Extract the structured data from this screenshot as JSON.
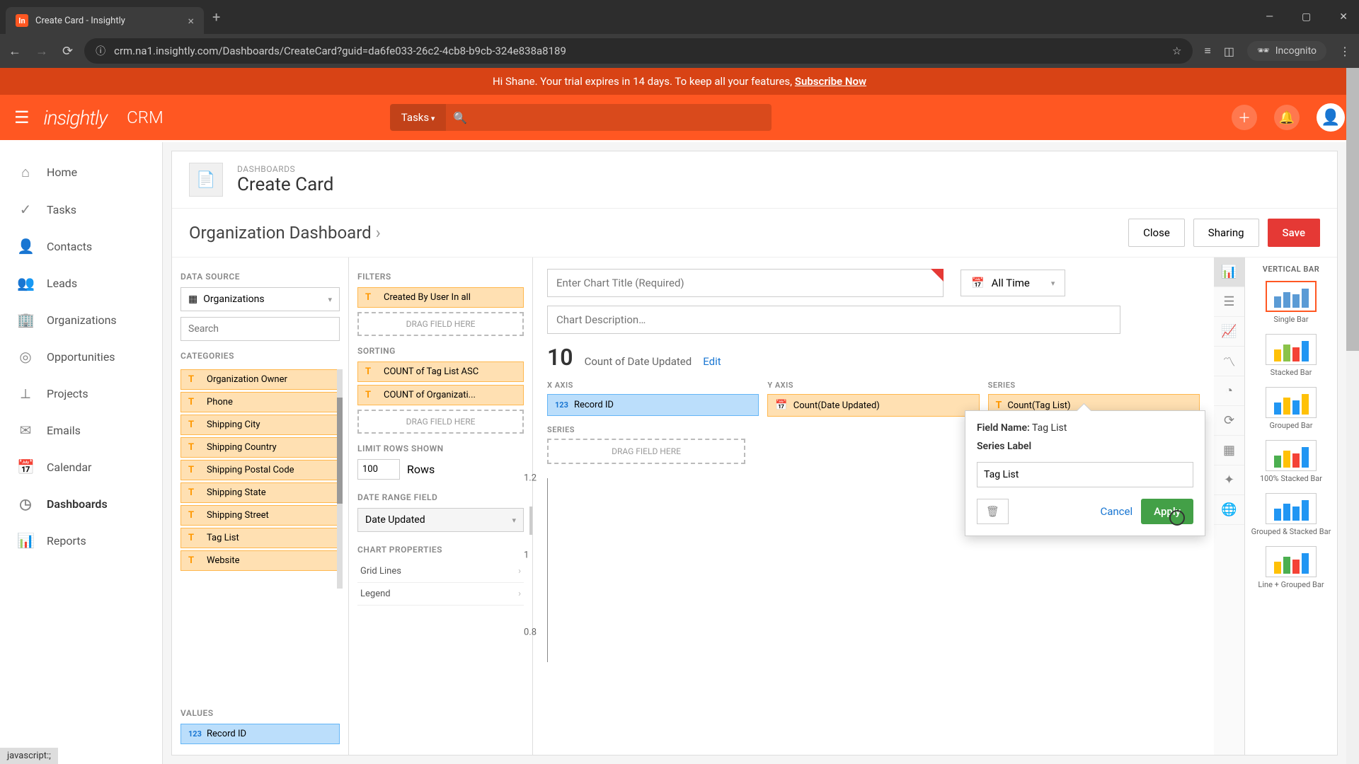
{
  "browser": {
    "tab_title": "Create Card - Insightly",
    "url": "crm.na1.insightly.com/Dashboards/CreateCard?guid=da6fe033-26c2-4cb8-b9cb-324e838a8189",
    "incognito_label": "Incognito"
  },
  "trial_banner": {
    "text_prefix": "Hi Shane. Your trial expires in 14 days. To keep all your features, ",
    "link": "Subscribe Now"
  },
  "topbar": {
    "logo": "insightly",
    "product": "CRM",
    "search_type": "Tasks"
  },
  "leftnav": {
    "items": [
      {
        "icon": "⌂",
        "label": "Home"
      },
      {
        "icon": "✓",
        "label": "Tasks"
      },
      {
        "icon": "👤",
        "label": "Contacts"
      },
      {
        "icon": "👥",
        "label": "Leads"
      },
      {
        "icon": "🏢",
        "label": "Organizations"
      },
      {
        "icon": "◎",
        "label": "Opportunities"
      },
      {
        "icon": "⟂",
        "label": "Projects"
      },
      {
        "icon": "✉",
        "label": "Emails"
      },
      {
        "icon": "📅",
        "label": "Calendar"
      },
      {
        "icon": "◷",
        "label": "Dashboards"
      },
      {
        "icon": "📊",
        "label": "Reports"
      }
    ],
    "active_index": 9
  },
  "page": {
    "breadcrumb": "DASHBOARDS",
    "title": "Create Card",
    "dashboard_name": "Organization Dashboard",
    "buttons": {
      "close": "Close",
      "sharing": "Sharing",
      "save": "Save"
    }
  },
  "data_source": {
    "label": "DATA SOURCE",
    "value": "Organizations",
    "search_placeholder": "Search"
  },
  "categories": {
    "label": "CATEGORIES",
    "items": [
      "Organization Owner",
      "Phone",
      "Shipping City",
      "Shipping Country",
      "Shipping Postal Code",
      "Shipping State",
      "Shipping Street",
      "Tag List",
      "Website"
    ]
  },
  "values": {
    "label": "VALUES",
    "items": [
      {
        "type": "123",
        "label": "Record ID"
      }
    ]
  },
  "filters": {
    "label": "FILTERS",
    "items": [
      "Created By User In all"
    ],
    "placeholder": "DRAG FIELD HERE"
  },
  "sorting": {
    "label": "SORTING",
    "items": [
      "COUNT of Tag List ASC",
      "COUNT of Organizati..."
    ],
    "placeholder": "DRAG FIELD HERE"
  },
  "limit": {
    "label": "LIMIT ROWS SHOWN",
    "value": "100",
    "suffix": "Rows"
  },
  "date_range": {
    "label": "DATE RANGE FIELD",
    "value": "Date Updated"
  },
  "chart_props": {
    "label": "CHART PROPERTIES",
    "items": [
      "Grid Lines",
      "Legend"
    ]
  },
  "chart": {
    "title_placeholder": "Enter Chart Title (Required)",
    "desc_placeholder": "Chart Description…",
    "time_range": "All Time",
    "metric_value": "10",
    "metric_label": "Count of Date Updated",
    "edit": "Edit",
    "xaxis": {
      "label": "X AXIS",
      "chip": "Record ID",
      "icon": "123"
    },
    "yaxis": {
      "label": "Y AXIS",
      "chip": "Count(Date Updated)",
      "icon": "📅"
    },
    "series": {
      "label": "SERIES",
      "chip": "Count(Tag List)",
      "icon": "T"
    },
    "series_section_label": "SERIES",
    "series_placeholder": "DRAG FIELD HERE"
  },
  "popup": {
    "field_name_label": "Field Name:",
    "field_name_value": "Tag List",
    "series_label": "Series Label",
    "input_value": "Tag List",
    "cancel": "Cancel",
    "apply": "Apply"
  },
  "chart_types": {
    "header": "VERTICAL BAR",
    "options": [
      "Single Bar",
      "Stacked Bar",
      "Grouped Bar",
      "100% Stacked Bar",
      "Grouped & Stacked Bar",
      "Line + Grouped Bar"
    ],
    "active_index": 0
  },
  "chart_data": {
    "type": "bar",
    "title": "",
    "ylabel": "",
    "ylim": [
      0,
      1.2
    ],
    "yticks": [
      0.8,
      1,
      1.2
    ],
    "categories": [],
    "values": []
  },
  "status_text": "javascript:;"
}
